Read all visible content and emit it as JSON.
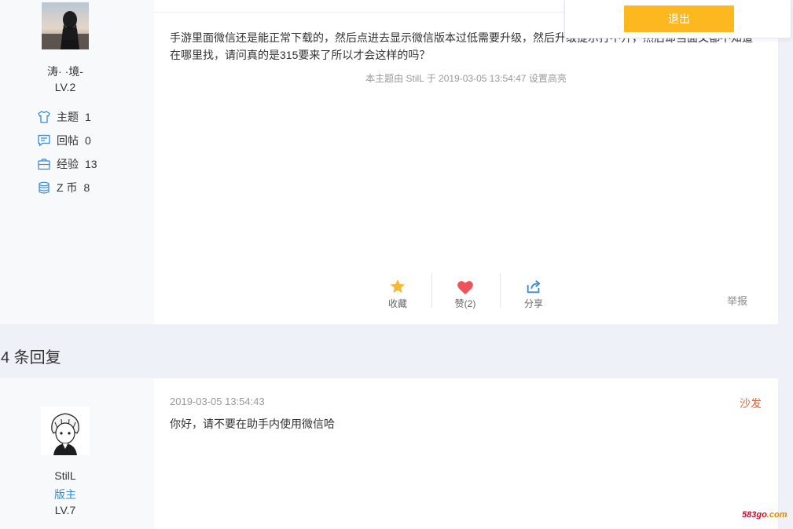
{
  "post": {
    "author": {
      "name": "涛·   ·境-",
      "level": "LV.2",
      "stats": [
        {
          "icon": "shirt-icon",
          "label": "主题",
          "value": "1"
        },
        {
          "icon": "comment-icon",
          "label": "回帖",
          "value": "0"
        },
        {
          "icon": "briefcase-icon",
          "label": "经验",
          "value": "13"
        },
        {
          "icon": "coins-icon",
          "label": "Z 币",
          "value": "8"
        }
      ]
    },
    "body": "手游里面微信还是能正常下载的，然后点进去显示微信版本过低需要升级，然后升级提示打不开，然后却当面又都不知道在哪里找，请问真的是315要来了所以才会这样的吗？",
    "meta": "本主题由 StilL 于 2019-03-05 13:54:47 设置高亮",
    "actions": {
      "favorite": "收藏",
      "like": "赞(2)",
      "share": "分享"
    },
    "report": "举报"
  },
  "replies": {
    "title": "4 条回复",
    "items": [
      {
        "author": "StilL",
        "role": "版主",
        "level": "LV.7",
        "time": "2019-03-05 13:54:43",
        "floor": "沙发",
        "text": "你好，请不要在助手内使用微信哈"
      }
    ]
  },
  "logout": {
    "label": "退出"
  },
  "watermark": {
    "part1": "583go",
    "part2": ".com"
  },
  "colors": {
    "accent_yellow": "#fdb820",
    "link_blue": "#3a8bd6",
    "floor_orange": "#e0643a",
    "like_red": "#f0525a",
    "star_yellow": "#f5b932"
  }
}
